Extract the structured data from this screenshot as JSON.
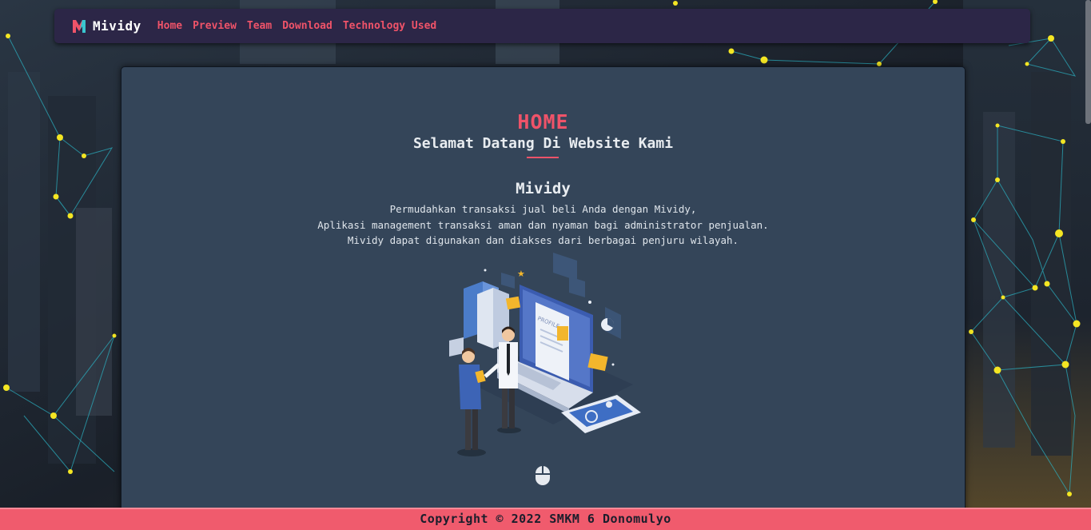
{
  "navbar": {
    "brand": "Mividy",
    "links": [
      "Home",
      "Preview",
      "Team",
      "Download",
      "Technology Used"
    ]
  },
  "home": {
    "title": "HOME",
    "subtitle": "Selamat Datang Di Website Kami",
    "app_name": "Mividy",
    "description": [
      "Permudahkan transaksi jual beli Anda dengan Mividy,",
      "Aplikasi management transaksi aman dan nyaman bagi administrator penjualan.",
      "Mividy dapat digunakan dan diakses dari berbagai penjuru wilayah."
    ],
    "illustration_label": "PROFILE"
  },
  "footer": {
    "copyright": "Copyright © 2022 SMKM 6 Donomulyo"
  },
  "icons": {
    "logo": "mividy-logo-icon",
    "scroll_hint": "mouse-scroll-icon"
  },
  "colors": {
    "accent": "#ef5369",
    "navbar": "#2c2647",
    "card": "#344559",
    "footer": "#f05b6d",
    "network_node": "#f4e623"
  }
}
